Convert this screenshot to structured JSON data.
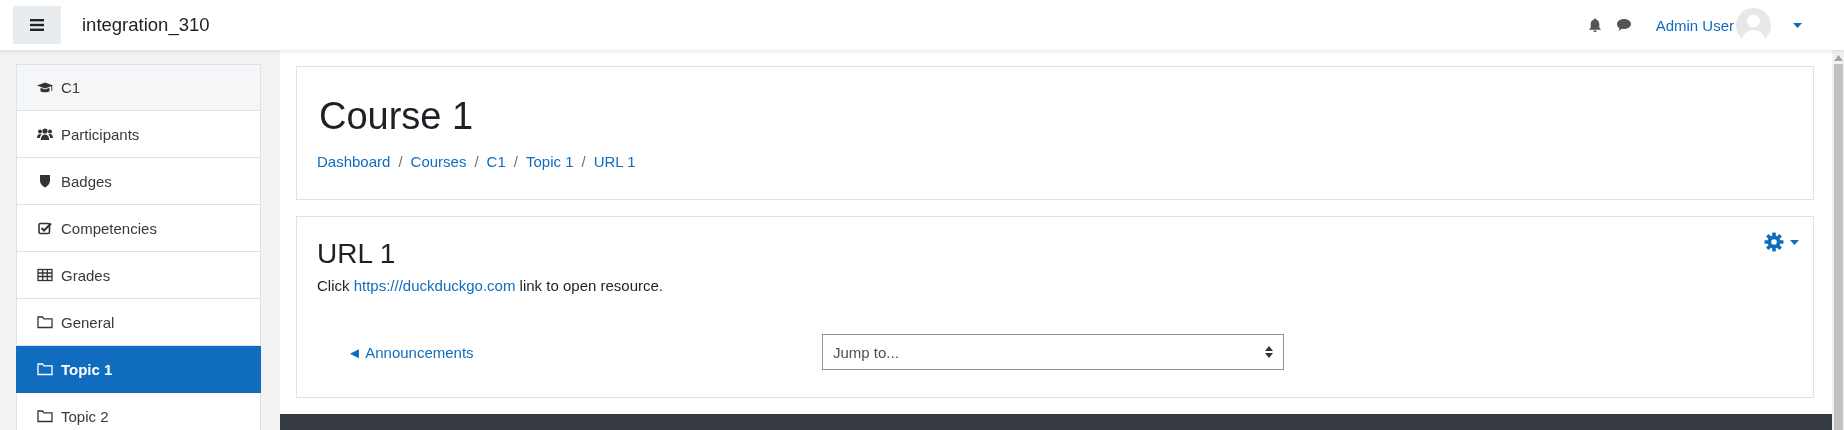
{
  "navbar": {
    "site_name": "integration_310",
    "user_name": "Admin User"
  },
  "sidebar": {
    "items": [
      {
        "label": "C1",
        "kind": "course",
        "selected": false
      },
      {
        "label": "Participants",
        "kind": "users",
        "selected": false
      },
      {
        "label": "Badges",
        "kind": "shield",
        "selected": false
      },
      {
        "label": "Competencies",
        "kind": "checkbox",
        "selected": false
      },
      {
        "label": "Grades",
        "kind": "table",
        "selected": false
      },
      {
        "label": "General",
        "kind": "folder",
        "selected": false
      },
      {
        "label": "Topic 1",
        "kind": "folder",
        "selected": true
      },
      {
        "label": "Topic 2",
        "kind": "folder",
        "selected": false
      }
    ]
  },
  "header_card": {
    "title": "Course 1",
    "breadcrumbs": [
      "Dashboard",
      "Courses",
      "C1",
      "Topic 1",
      "URL 1"
    ],
    "separator": "/"
  },
  "content_card": {
    "title": "URL 1",
    "intro_before": "Click",
    "link": "https:///duckduckgo.com",
    "intro_after": "link to open resource.",
    "prev_link": "◄ Announcements",
    "jump_select": {
      "value": "Jump to..."
    }
  }
}
